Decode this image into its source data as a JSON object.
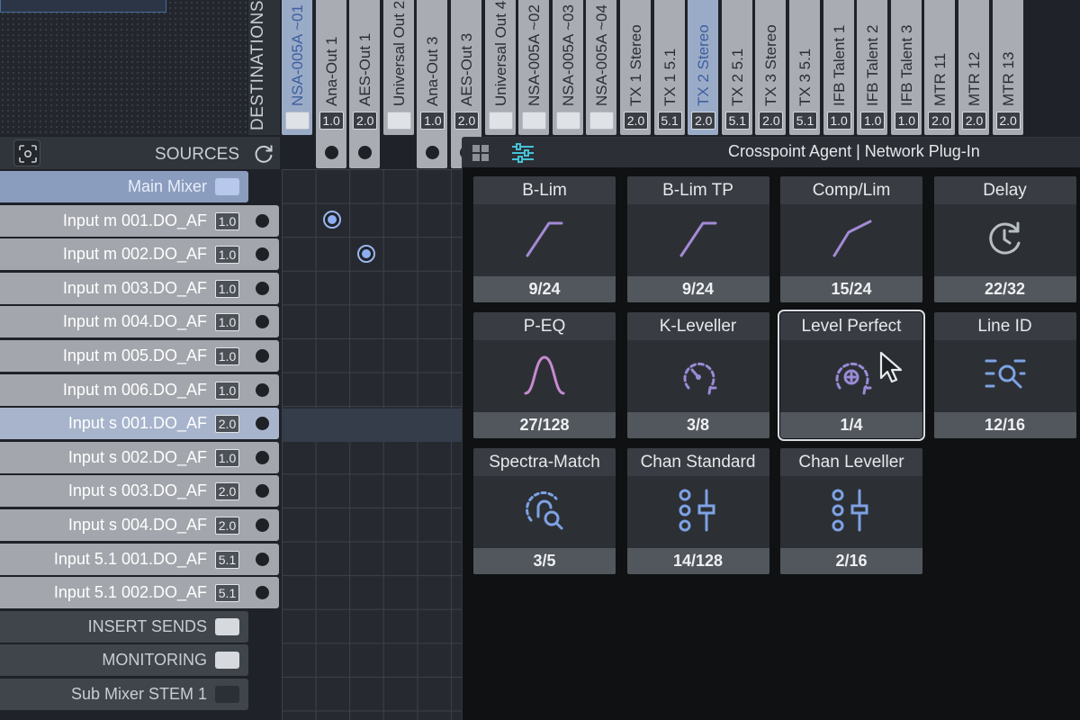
{
  "destinations": {
    "label": "DESTINATIONS",
    "columns": [
      {
        "name": "NSA-005A ~01",
        "badge": "",
        "selected": true,
        "stub": false
      },
      {
        "name": "Ana-Out 1",
        "badge": "1.0",
        "selected": false,
        "stub": true
      },
      {
        "name": "AES-Out 1",
        "badge": "2.0",
        "selected": false,
        "stub": true
      },
      {
        "name": "Universal Out 2",
        "badge": "",
        "selected": false,
        "stub": false
      },
      {
        "name": "Ana-Out 3",
        "badge": "1.0",
        "selected": false,
        "stub": true
      },
      {
        "name": "AES-Out 3",
        "badge": "2.0",
        "selected": false,
        "stub": true
      },
      {
        "name": "Universal Out 4",
        "badge": "",
        "selected": false,
        "stub": false
      },
      {
        "name": "NSA-005A ~02",
        "badge": "",
        "selected": false,
        "stub": false
      },
      {
        "name": "NSA-005A ~03",
        "badge": "",
        "selected": false,
        "stub": false
      },
      {
        "name": "NSA-005A ~04",
        "badge": "",
        "selected": false,
        "stub": false
      },
      {
        "name": "TX 1 Stereo",
        "badge": "2.0",
        "selected": false,
        "stub": false
      },
      {
        "name": "TX 1 5.1",
        "badge": "5.1",
        "selected": false,
        "stub": false
      },
      {
        "name": "TX 2 Stereo",
        "badge": "2.0",
        "selected": true,
        "stub": false
      },
      {
        "name": "TX 2 5.1",
        "badge": "5.1",
        "selected": false,
        "stub": false
      },
      {
        "name": "TX 3 Stereo",
        "badge": "2.0",
        "selected": false,
        "stub": false
      },
      {
        "name": "TX 3 5.1",
        "badge": "5.1",
        "selected": false,
        "stub": false
      },
      {
        "name": "IFB Talent 1",
        "badge": "1.0",
        "selected": false,
        "stub": false
      },
      {
        "name": "IFB Talent 2",
        "badge": "1.0",
        "selected": false,
        "stub": false
      },
      {
        "name": "IFB Talent 3",
        "badge": "1.0",
        "selected": false,
        "stub": false
      },
      {
        "name": "MTR 11",
        "badge": "2.0",
        "selected": false,
        "stub": false
      },
      {
        "name": "MTR 12",
        "badge": "2.0",
        "selected": false,
        "stub": false
      },
      {
        "name": "MTR 13",
        "badge": "2.0",
        "selected": false,
        "stub": false
      }
    ]
  },
  "sources": {
    "title": "SOURCES",
    "groups_top": {
      "main": "Main Mixer"
    },
    "rows": [
      {
        "label": "Input m 001.DO_AF",
        "badge": "1.0",
        "selected": false
      },
      {
        "label": "Input m 002.DO_AF",
        "badge": "1.0",
        "selected": false
      },
      {
        "label": "Input m 003.DO_AF",
        "badge": "1.0",
        "selected": false
      },
      {
        "label": "Input m 004.DO_AF",
        "badge": "1.0",
        "selected": false
      },
      {
        "label": "Input m 005.DO_AF",
        "badge": "1.0",
        "selected": false
      },
      {
        "label": "Input m 006.DO_AF",
        "badge": "1.0",
        "selected": false
      },
      {
        "label": "Input s 001.DO_AF",
        "badge": "2.0",
        "selected": true
      },
      {
        "label": "Input s 002.DO_AF",
        "badge": "1.0",
        "selected": false
      },
      {
        "label": "Input s 003.DO_AF",
        "badge": "2.0",
        "selected": false
      },
      {
        "label": "Input s 004.DO_AF",
        "badge": "2.0",
        "selected": false
      },
      {
        "label": "Input 5.1 001.DO_AF",
        "badge": "5.1",
        "selected": false
      },
      {
        "label": "Input 5.1 002.DO_AF",
        "badge": "5.1",
        "selected": false
      }
    ],
    "groups_bottom": [
      {
        "label": "INSERT SENDS",
        "dark": false
      },
      {
        "label": "MONITORING",
        "dark": false
      },
      {
        "label": "Sub Mixer STEM 1",
        "dark": true
      }
    ]
  },
  "crosspoints": [
    {
      "row": 0,
      "col": 1
    },
    {
      "row": 1,
      "col": 2
    }
  ],
  "panel": {
    "title": "Crosspoint Agent | Network Plug-In",
    "tiles": [
      {
        "name": "B-Lim",
        "count": "9/24",
        "icon": "limiter-curve-icon",
        "color": "#a48ad6",
        "active": false
      },
      {
        "name": "B-Lim TP",
        "count": "9/24",
        "icon": "limiter-curve-icon",
        "color": "#a48ad6",
        "active": false
      },
      {
        "name": "Comp/Lim",
        "count": "15/24",
        "icon": "compressor-curve-icon",
        "color": "#a48ad6",
        "active": false
      },
      {
        "name": "Delay",
        "count": "22/32",
        "icon": "clock-icon",
        "color": "#b9bec4",
        "active": false
      },
      {
        "name": "P-EQ",
        "count": "27/128",
        "icon": "bell-curve-icon",
        "color": "#c68ad0",
        "active": false
      },
      {
        "name": "K-Leveller",
        "count": "3/8",
        "icon": "gauge-arrow-icon",
        "color": "#9a8ad6",
        "active": false
      },
      {
        "name": "Level Perfect",
        "count": "1/4",
        "icon": "gauge-plus-icon",
        "color": "#9a8ad6",
        "active": true
      },
      {
        "name": "Line ID",
        "count": "12/16",
        "icon": "line-search-icon",
        "color": "#7ea2e4",
        "active": false
      },
      {
        "name": "Spectra-Match",
        "count": "3/5",
        "icon": "fingerprint-search-icon",
        "color": "#7ea2e4",
        "active": false
      },
      {
        "name": "Chan Standard",
        "count": "14/128",
        "icon": "channel-fader-icon",
        "color": "#7ea2e4",
        "active": false
      },
      {
        "name": "Chan Leveller",
        "count": "2/16",
        "icon": "channel-fader-icon",
        "color": "#7ea2e4",
        "active": false
      }
    ]
  }
}
